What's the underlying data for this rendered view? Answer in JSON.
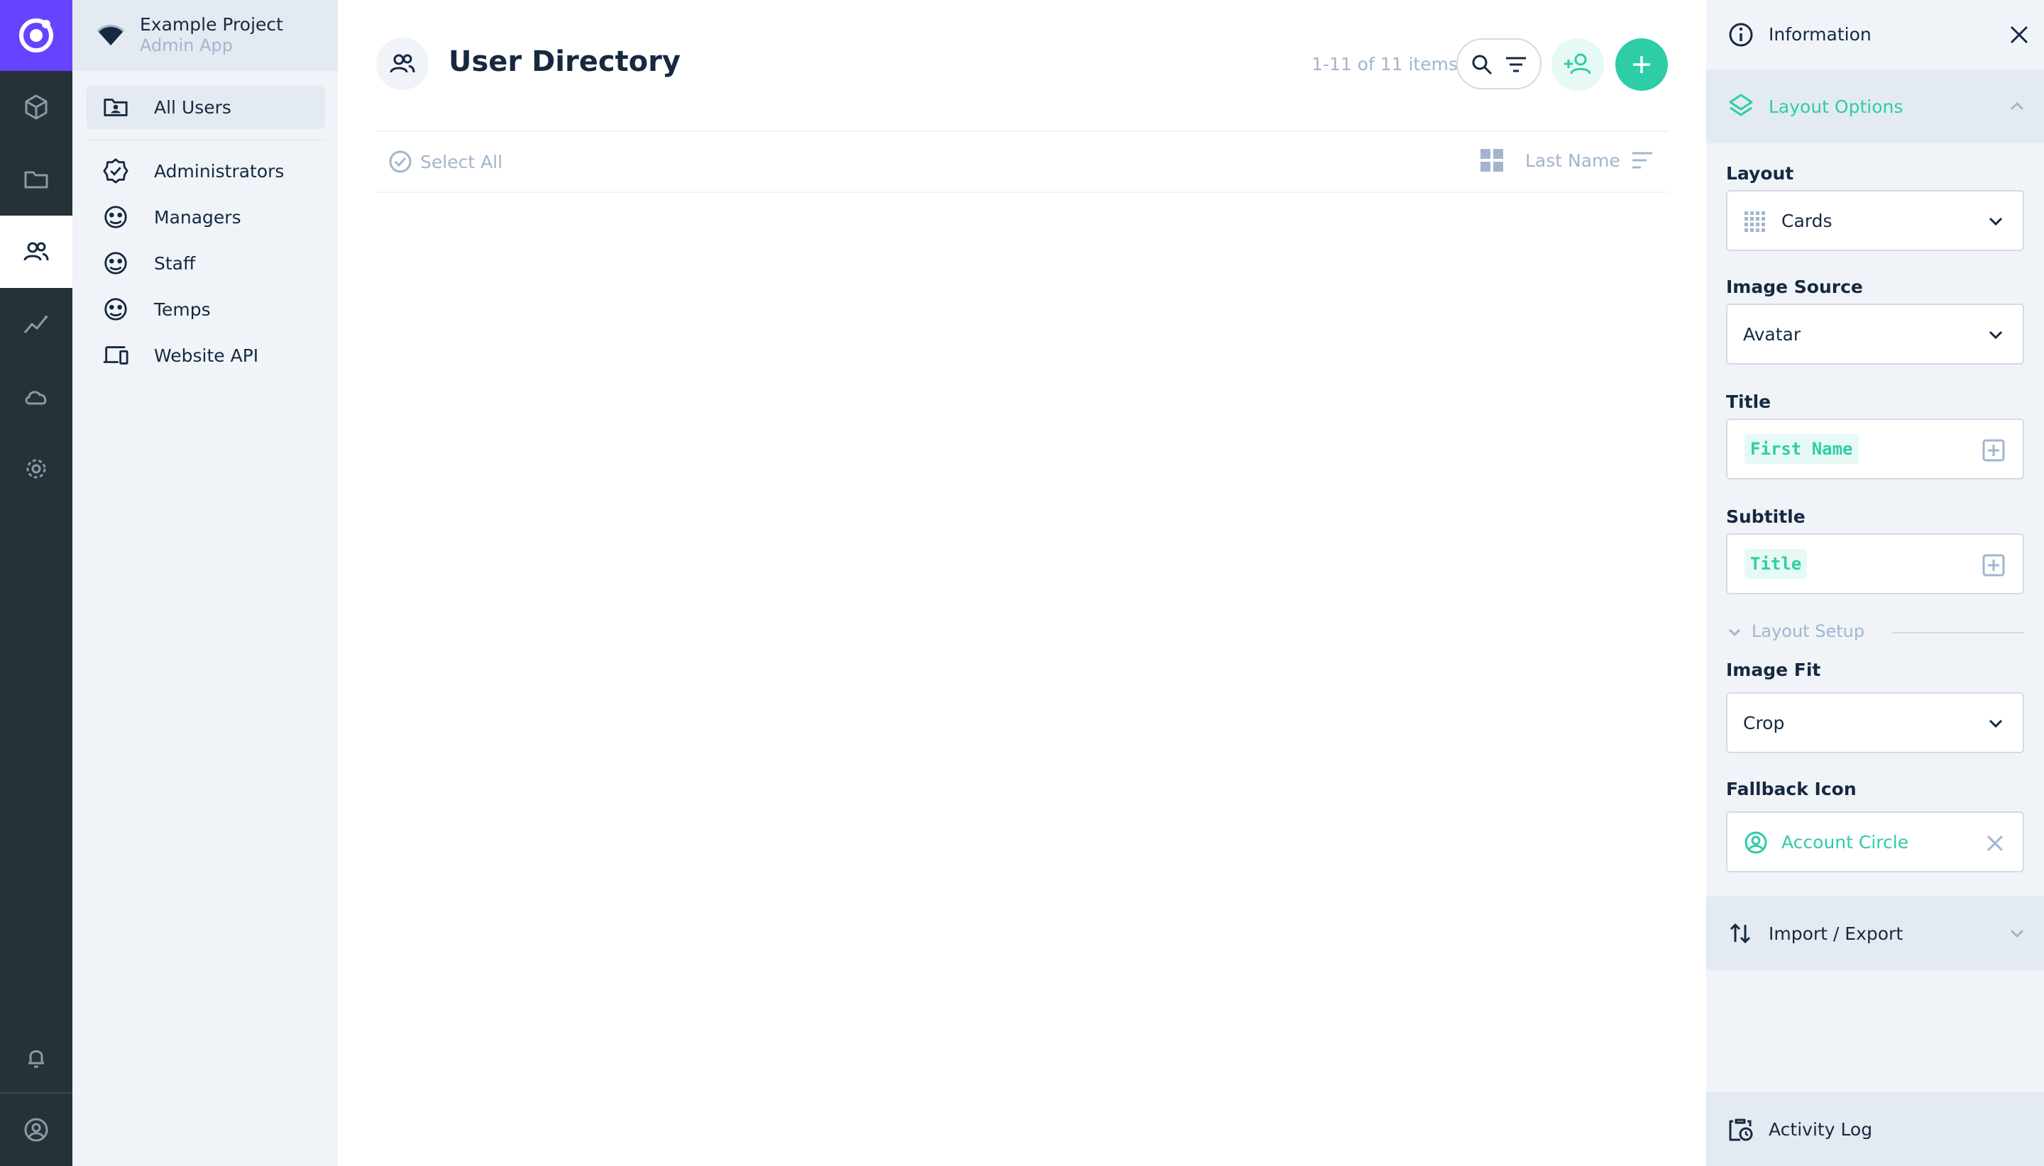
{
  "app": {
    "project_name": "Example Project",
    "project_sub": "Admin App"
  },
  "nav": {
    "items": [
      {
        "label": "All Users"
      },
      {
        "label": "Administrators"
      },
      {
        "label": "Managers"
      },
      {
        "label": "Staff"
      },
      {
        "label": "Temps"
      },
      {
        "label": "Website API"
      }
    ]
  },
  "main": {
    "title": "User Directory",
    "item_count": "1-11 of 11 items",
    "select_all": "Select All",
    "sort_label": "Last Name"
  },
  "info": {
    "title": "Information",
    "layout_options": "Layout Options",
    "layout_label": "Layout",
    "layout_value": "Cards",
    "image_source_label": "Image Source",
    "image_source_value": "Avatar",
    "title_label": "Title",
    "title_tag": "First Name",
    "subtitle_label": "Subtitle",
    "subtitle_tag": "Title",
    "layout_setup": "Layout Setup",
    "image_fit_label": "Image Fit",
    "image_fit_value": "Crop",
    "fallback_icon_label": "Fallback Icon",
    "fallback_icon_value": "Account Circle",
    "import_export": "Import / Export",
    "activity_log": "Activity Log"
  },
  "colors": {
    "accent": "#2ecda7",
    "brand": "#6644ff",
    "rail": "#263238"
  }
}
